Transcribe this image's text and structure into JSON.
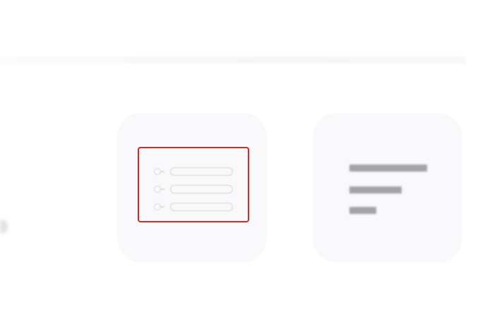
{
  "screen": {
    "background": "#ffffff",
    "accent_selection_color": "#e02424"
  },
  "options": [
    {
      "id": "list",
      "icon": "radio-list-icon",
      "rows": 3,
      "selected": true
    },
    {
      "id": "text",
      "icon": "text-lines-icon",
      "lines": 3,
      "selected": false
    }
  ]
}
